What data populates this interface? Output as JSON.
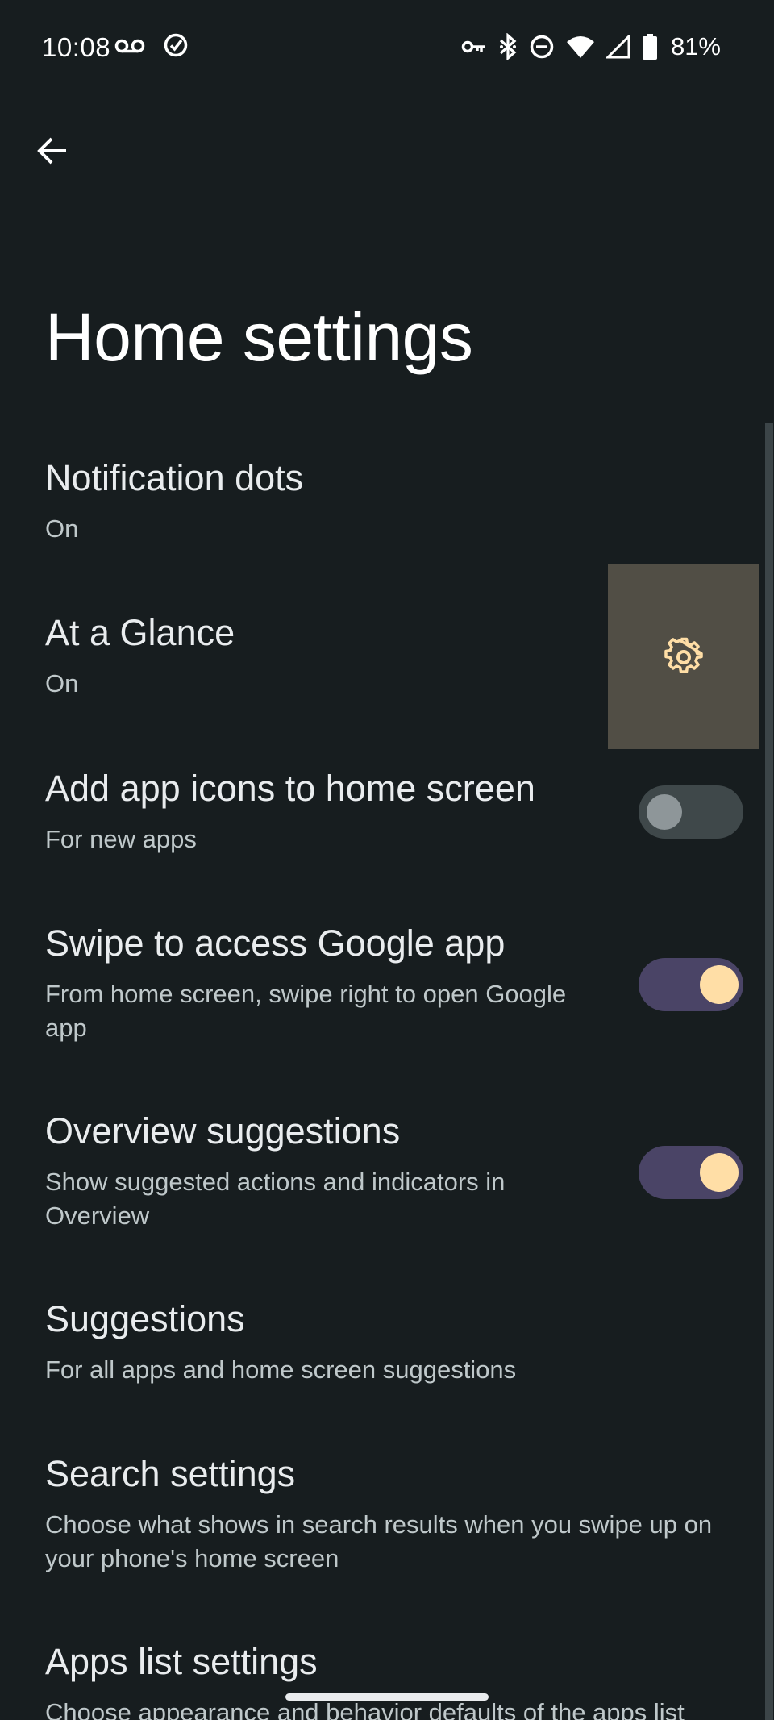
{
  "status_bar": {
    "time": "10:08",
    "battery": "81%",
    "left_icons": [
      "voicemail-icon",
      "check-circle-icon"
    ],
    "right_icons": [
      "vpn-key-icon",
      "bluetooth-icon",
      "do-not-disturb-icon",
      "wifi-icon",
      "signal-icon",
      "battery-icon"
    ]
  },
  "header": {
    "back_icon": "arrow-back-icon",
    "title": "Home settings"
  },
  "settings": [
    {
      "title": "Notification dots",
      "summary": "On",
      "control": "none"
    },
    {
      "title": "At a Glance",
      "summary": "On",
      "control": "settings-gear"
    },
    {
      "title": "Add app icons to home screen",
      "summary": "For new apps",
      "control": "switch",
      "checked": false
    },
    {
      "title": "Swipe to access Google app",
      "summary": "From home screen, swipe right to open Google app",
      "control": "switch",
      "checked": true
    },
    {
      "title": "Overview suggestions",
      "summary": "Show suggested actions and indicators in Overview",
      "control": "switch",
      "checked": true
    },
    {
      "title": "Suggestions",
      "summary": "For all apps and home screen suggestions",
      "control": "none"
    },
    {
      "title": "Search settings",
      "summary": "Choose what shows in search results when you swipe up on your phone's home screen",
      "control": "none"
    },
    {
      "title": "Apps list settings",
      "summary": "Choose appearance and behavior defaults of the apps list",
      "control": "none"
    }
  ],
  "colors": {
    "background": "#171d1f",
    "switch_on_track": "#4a4466",
    "switch_on_thumb": "#ffdea6",
    "switch_off_track": "#3f484a",
    "switch_off_thumb": "#8e9699",
    "gear_highlight": "#514e45",
    "gear_icon": "#ffdea6"
  }
}
